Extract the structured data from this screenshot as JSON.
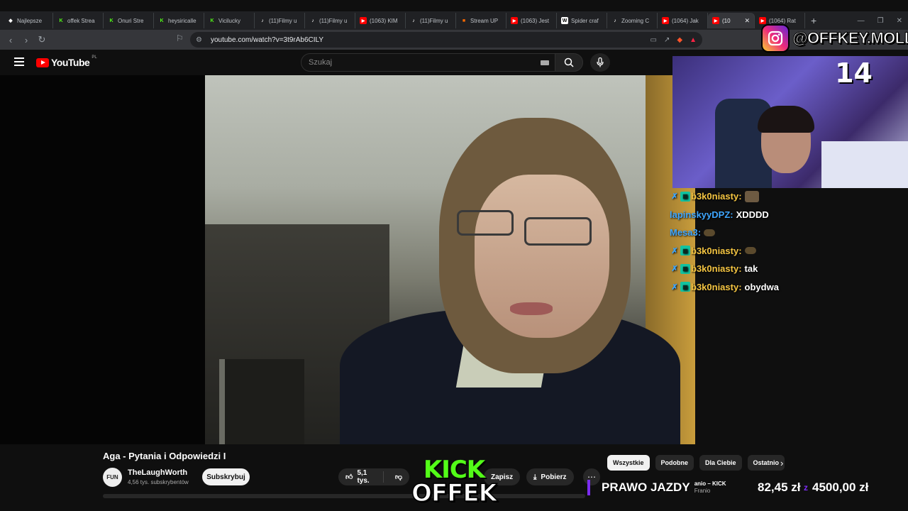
{
  "browser": {
    "tabs": [
      {
        "label": "Najlepsze",
        "icon": "gem-icon",
        "color": "#ffffff"
      },
      {
        "label": "offek Strea",
        "icon": "kick-icon",
        "color": "#53fc18"
      },
      {
        "label": "Onuri Stre",
        "icon": "kick-icon",
        "color": "#53fc18"
      },
      {
        "label": "heysiricalle",
        "icon": "kick-icon",
        "color": "#53fc18"
      },
      {
        "label": "Vicilucky",
        "icon": "kick-icon",
        "color": "#53fc18"
      },
      {
        "label": "(11)Filmy u",
        "icon": "tiktok-icon",
        "color": "#ffffff"
      },
      {
        "label": "(11)Filmy u",
        "icon": "tiktok-icon",
        "color": "#ffffff"
      },
      {
        "label": "(1063) KIM",
        "icon": "youtube-icon",
        "color": "#ff0000"
      },
      {
        "label": "(11)Filmy u",
        "icon": "tiktok-icon",
        "color": "#ffffff"
      },
      {
        "label": "Stream UP",
        "icon": "streamup-icon",
        "color": "#ff6a00"
      },
      {
        "label": "(1063) Jest",
        "icon": "youtube-icon",
        "color": "#ff0000"
      },
      {
        "label": "Spider craf",
        "icon": "wikipedia-icon",
        "color": "#ffffff"
      },
      {
        "label": "Zooming C",
        "icon": "tiktok-icon",
        "color": "#ffffff"
      },
      {
        "label": "(1064) Jak",
        "icon": "youtube-icon",
        "color": "#ff0000"
      },
      {
        "label": "(10",
        "icon": "youtube-icon",
        "color": "#ff0000",
        "active": true
      },
      {
        "label": "(1064) Rat",
        "icon": "youtube-icon",
        "color": "#ff0000"
      }
    ],
    "url": "youtube.com/watch?v=3t9rAb6CILY"
  },
  "youtube": {
    "logo_text": "YouTube",
    "region": "PL",
    "search_placeholder": "Szukaj"
  },
  "video": {
    "title": "Aga - Pytania i Odpowiedzi I",
    "channel_avatar_text": "FUN",
    "channel_name": "TheLaughWorth",
    "channel_subs": "4,56 tys. subskrybentów",
    "subscribe_label": "Subskrybuj",
    "likes": "5,1 tys.",
    "save_label": "Zapisz",
    "download_label": "Pobierz"
  },
  "chips": [
    "Wszystkie",
    "Podobne",
    "Dla Ciebie",
    "Ostatnio"
  ],
  "stream": {
    "instagram_handle": "@OFFKEY.MOLLY",
    "cam_number": "14",
    "kick_line1": "KICK",
    "kick_line2": "OFFEK",
    "ticker_label": "PRAWO JAZDY",
    "ticker_user": "anio – KICK",
    "ticker_user_sub": "Franio",
    "ticker_amount": "82,45 zł",
    "ticker_separator": "z",
    "ticker_goal": "4500,00 zł",
    "goal_progress_percent": 1.8
  },
  "chat": [
    {
      "user": "b3k0niasty:",
      "text": "",
      "color": "#f5c542",
      "badges": true,
      "emote": "face"
    },
    {
      "user": "lapinskyyDPZ:",
      "text": "XDDDD",
      "color": "#3ea6ff",
      "badges": false
    },
    {
      "user": "Mesa3:",
      "text": "",
      "color": "#3ea6ff",
      "badges": false,
      "emote": "small"
    },
    {
      "user": "b3k0niasty:",
      "text": "",
      "color": "#f5c542",
      "badges": true,
      "emote": "small"
    },
    {
      "user": "b3k0niasty:",
      "text": "tak",
      "color": "#f5c542",
      "badges": true
    },
    {
      "user": "b3k0niasty:",
      "text": "obydwa",
      "color": "#f5c542",
      "badges": true
    }
  ]
}
